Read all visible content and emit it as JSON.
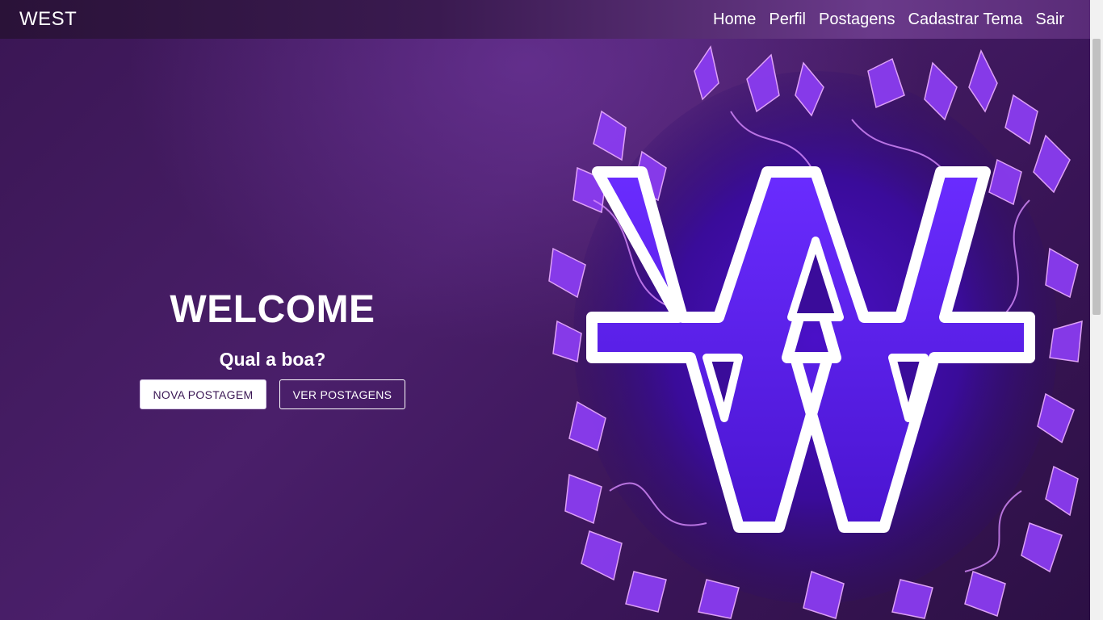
{
  "navbar": {
    "brand": "WEST",
    "links": [
      "Home",
      "Perfil",
      "Postagens",
      "Cadastrar Tema",
      "Sair"
    ]
  },
  "hero": {
    "title": "WELCOME",
    "subtitle": "Qual a boa?",
    "primary_button": "NOVA POSTAGEM",
    "secondary_button": "VER POSTAGENS"
  },
  "colors": {
    "background": "#3a1654",
    "accent": "#7a2cff",
    "flame": "#c060ff"
  },
  "icons": {
    "logo": "won-sign-flame-logo"
  }
}
